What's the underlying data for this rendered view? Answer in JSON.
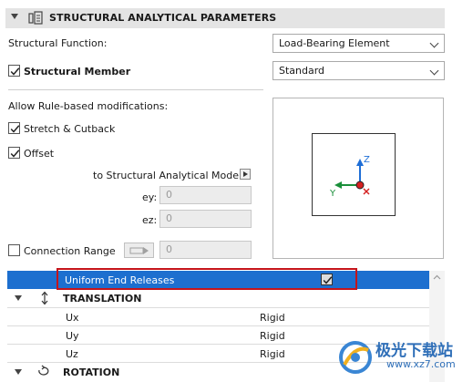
{
  "header": {
    "title": "STRUCTURAL ANALYTICAL PARAMETERS"
  },
  "structural_function": {
    "label": "Structural Function:",
    "value": "Load-Bearing Element"
  },
  "structural_member": {
    "label": "Structural Member",
    "checked": true,
    "value": "Standard"
  },
  "rule_based": {
    "label": "Allow Rule-based modifications:"
  },
  "stretch_cutback": {
    "label": "Stretch & Cutback",
    "checked": true
  },
  "offset": {
    "label": "Offset",
    "checked": true
  },
  "to_model": {
    "label": "to Structural Analytical Model"
  },
  "ey": {
    "label": "ey:",
    "value": "0"
  },
  "ez": {
    "label": "ez:",
    "value": "0"
  },
  "connection_range": {
    "label": "Connection Range",
    "checked": false,
    "value": "0"
  },
  "axes": {
    "z": "Z",
    "y": "Y",
    "green": "#1a8f3a",
    "blue": "#1e6ed6",
    "red": "#d42020"
  },
  "table": {
    "selected_row": {
      "label": "Uniform End Releases",
      "checked": true
    },
    "groups": [
      {
        "label": "TRANSLATION",
        "icon": "vertical-arrows-icon"
      },
      {
        "label": "ROTATION",
        "icon": "rotation-icon"
      }
    ],
    "rows": [
      {
        "name": "Ux",
        "value": "Rigid"
      },
      {
        "name": "Uy",
        "value": "Rigid"
      },
      {
        "name": "Uz",
        "value": "Rigid"
      }
    ]
  },
  "watermark": {
    "title": "极光下载站",
    "url": "www.xz7.com"
  },
  "colors": {
    "selection": "#1d6fcf",
    "highlight_border": "#c4141b",
    "header_bg": "#e4e4e4"
  }
}
